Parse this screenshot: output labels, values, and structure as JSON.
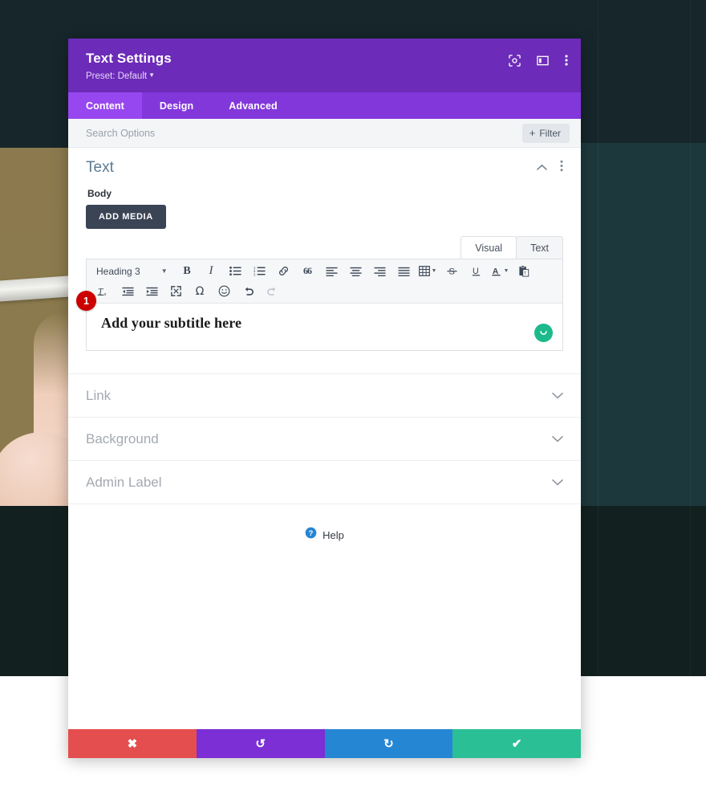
{
  "modal": {
    "title": "Text Settings",
    "preset": "Preset: Default",
    "header_icons": [
      {
        "name": "focus-icon"
      },
      {
        "name": "layout-panel-icon"
      },
      {
        "name": "more-vertical-icon"
      }
    ],
    "tabs": [
      {
        "label": "Content",
        "active": true
      },
      {
        "label": "Design",
        "active": false
      },
      {
        "label": "Advanced",
        "active": false
      }
    ],
    "search": {
      "placeholder": "Search Options",
      "value": ""
    },
    "filter": {
      "label": "Filter",
      "plus": "+"
    }
  },
  "text_section": {
    "title": "Text",
    "collapse_icon": "chevron-up-icon",
    "more_icon": "more-vertical-icon",
    "field_label": "Body",
    "add_media_label": "ADD MEDIA",
    "editor_tabs": [
      {
        "label": "Visual",
        "active": true
      },
      {
        "label": "Text",
        "active": false
      }
    ],
    "format_select": {
      "value": "Heading 3"
    },
    "toolbar_row1": [
      {
        "name": "bold-icon",
        "glyph": "B"
      },
      {
        "name": "italic-icon",
        "glyph": "I"
      },
      {
        "name": "bullet-list-icon",
        "glyph": ""
      },
      {
        "name": "numbered-list-icon",
        "glyph": ""
      },
      {
        "name": "link-icon",
        "glyph": ""
      },
      {
        "name": "blockquote-icon",
        "glyph": "66"
      },
      {
        "name": "align-left-icon",
        "glyph": ""
      },
      {
        "name": "align-center-icon",
        "glyph": ""
      },
      {
        "name": "align-right-icon",
        "glyph": ""
      },
      {
        "name": "align-justify-icon",
        "glyph": ""
      },
      {
        "name": "table-icon",
        "glyph": ""
      },
      {
        "name": "strikethrough-icon",
        "glyph": "S"
      },
      {
        "name": "underline-icon",
        "glyph": "U"
      },
      {
        "name": "text-color-icon",
        "glyph": "A"
      },
      {
        "name": "paste-as-text-icon",
        "glyph": ""
      }
    ],
    "toolbar_row2": [
      {
        "name": "clear-formatting-icon"
      },
      {
        "name": "outdent-icon"
      },
      {
        "name": "indent-icon"
      },
      {
        "name": "fullscreen-icon"
      },
      {
        "name": "special-character-icon",
        "glyph": "Ω"
      },
      {
        "name": "emoticon-icon"
      },
      {
        "name": "undo-icon"
      },
      {
        "name": "redo-icon"
      }
    ],
    "content": "Add your subtitle here",
    "grammar_icon": "grammarly-smile-icon",
    "step_badge": "1"
  },
  "accordions": [
    {
      "label": "Link",
      "icon": "chevron-down-icon"
    },
    {
      "label": "Background",
      "icon": "chevron-down-icon"
    },
    {
      "label": "Admin Label",
      "icon": "chevron-down-icon"
    }
  ],
  "help": {
    "label": "Help",
    "icon": "help-circle-icon"
  },
  "footer": [
    {
      "name": "cancel-button",
      "icon": "close-icon",
      "glyph": "✖",
      "color": "#e54e4e"
    },
    {
      "name": "undo-button",
      "icon": "undo-icon",
      "glyph": "↺",
      "color": "#7b2fd4"
    },
    {
      "name": "redo-button",
      "icon": "redo-icon",
      "glyph": "↻",
      "color": "#2586d4"
    },
    {
      "name": "save-button",
      "icon": "check-icon",
      "glyph": "✔",
      "color": "#2bbf96"
    }
  ],
  "colors": {
    "header_purple": "#6c2bb8",
    "tabbar_purple": "#8237db",
    "active_tab_purple": "#9747ef",
    "backdrop_dark": "#1d383c",
    "badge_red": "#cc0000",
    "grammar_green": "#1bb98b"
  }
}
